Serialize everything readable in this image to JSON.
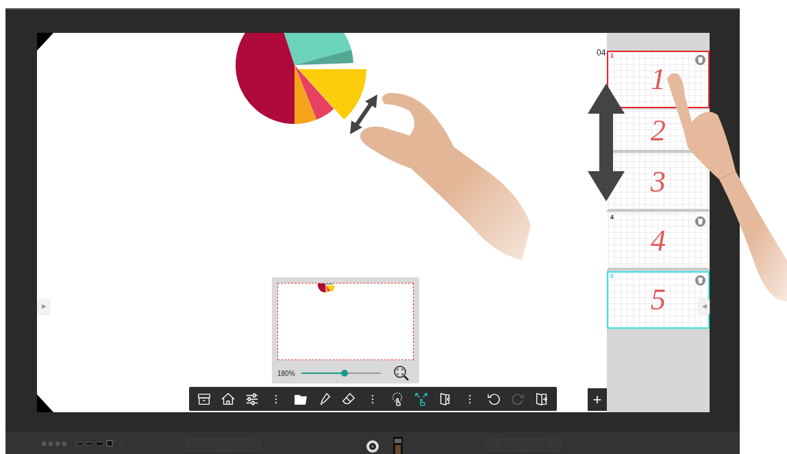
{
  "canvas": {
    "counter": "04",
    "left_handle": "▶"
  },
  "navigator": {
    "zoom": "180%",
    "level": 0.54
  },
  "toolbar": {
    "items": [
      {
        "kind": "button",
        "selected": false,
        "disabled": false
      },
      {
        "kind": "button",
        "selected": false,
        "disabled": false
      },
      {
        "kind": "button",
        "selected": false,
        "disabled": false
      },
      {
        "kind": "separator"
      },
      {
        "kind": "button",
        "selected": false,
        "disabled": false
      },
      {
        "kind": "button",
        "selected": false,
        "disabled": false
      },
      {
        "kind": "button",
        "selected": false,
        "disabled": false
      },
      {
        "kind": "separator"
      },
      {
        "kind": "button",
        "selected": false,
        "disabled": false
      },
      {
        "kind": "button",
        "selected": true,
        "disabled": false
      },
      {
        "kind": "button",
        "selected": false,
        "disabled": false
      },
      {
        "kind": "separator"
      },
      {
        "kind": "button",
        "selected": false,
        "disabled": false
      },
      {
        "kind": "button",
        "selected": false,
        "disabled": true
      },
      {
        "kind": "button",
        "selected": false,
        "disabled": false
      }
    ]
  },
  "add_page_button": "+",
  "pages": [
    {
      "number": "1",
      "handwriting": "1",
      "selected": false,
      "dragging": true,
      "delete_button": true
    },
    {
      "handwriting": "2",
      "selected": false,
      "dragging": false,
      "delete_button": false
    },
    {
      "handwriting": "3",
      "selected": false,
      "dragging": false,
      "delete_button": false
    },
    {
      "number": "4",
      "handwriting": "4",
      "selected": false,
      "dragging": false,
      "delete_button": true
    },
    {
      "number": "5",
      "handwriting": "5",
      "selected": true,
      "dragging": false,
      "delete_button": true
    }
  ],
  "right_handle": "◀"
}
